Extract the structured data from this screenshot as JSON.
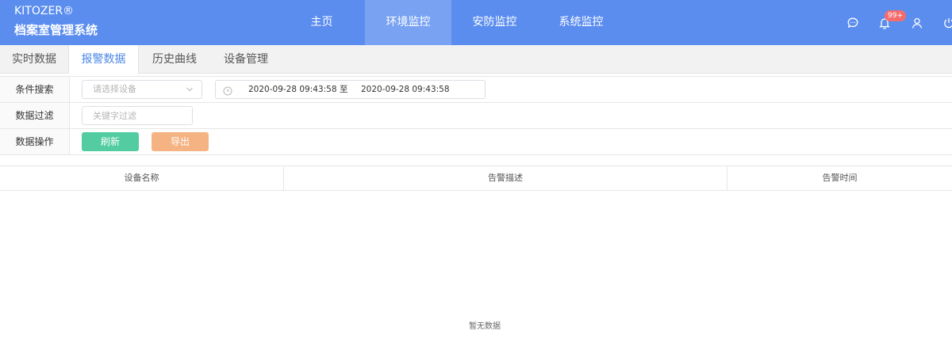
{
  "brand": {
    "name": "KITOZER®",
    "subtitle": "档案室管理系统"
  },
  "nav": [
    {
      "label": "主页"
    },
    {
      "label": "环境监控"
    },
    {
      "label": "安防监控"
    },
    {
      "label": "系统监控"
    }
  ],
  "header_icons": {
    "chat": "chat-bubble-icon",
    "bell": "bell-icon",
    "user": "user-icon",
    "power": "power-icon",
    "badge": "99+"
  },
  "subtabs": [
    {
      "label": "实时数据"
    },
    {
      "label": "报警数据"
    },
    {
      "label": "历史曲线"
    },
    {
      "label": "设备管理"
    }
  ],
  "filter": {
    "search_label": "条件搜索",
    "device_placeholder": "请选择设备",
    "date_start": "2020-09-28 09:43:58",
    "date_sep": "至",
    "date_end": "2020-09-28 09:43:58",
    "filter_label": "数据过滤",
    "keyword_placeholder": "关键字过滤",
    "ops_label": "数据操作",
    "refresh_label": "刷新",
    "export_label": "导出"
  },
  "table": {
    "columns": [
      "设备名称",
      "告警描述",
      "告警时间"
    ],
    "empty_text": "暂无数据"
  },
  "colors": {
    "header_bg": "#5b8def",
    "nav_active_bg": "#79a3f2",
    "tab_active_text": "#4a86e8",
    "refresh_btn": "#52cca0",
    "export_btn": "#f5b383",
    "badge": "#f56c6c"
  }
}
